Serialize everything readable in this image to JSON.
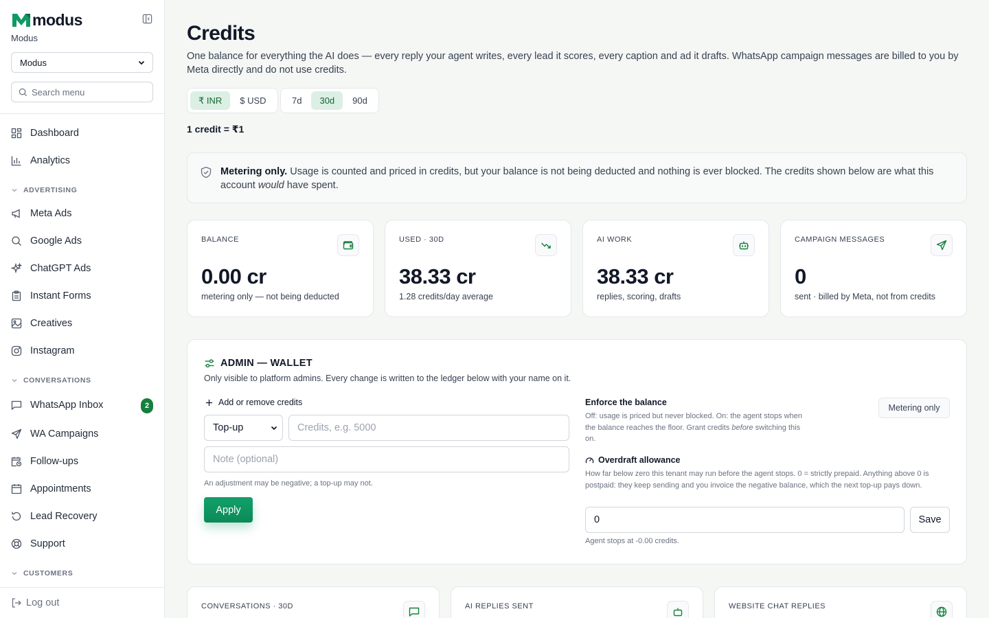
{
  "sidebar": {
    "brand_name": "modus",
    "org_label": "Modus",
    "org_select_value": "Modus",
    "search_placeholder": "Search menu",
    "nav": {
      "dashboard": "Dashboard",
      "analytics": "Analytics",
      "section_advertising": "ADVERTISING",
      "meta_ads": "Meta Ads",
      "google_ads": "Google Ads",
      "chatgpt_ads": "ChatGPT Ads",
      "instant_forms": "Instant Forms",
      "creatives": "Creatives",
      "instagram": "Instagram",
      "section_conversations": "CONVERSATIONS",
      "whatsapp_inbox": "WhatsApp Inbox",
      "whatsapp_inbox_badge": "2",
      "wa_campaigns": "WA Campaigns",
      "follow_ups": "Follow-ups",
      "appointments": "Appointments",
      "lead_recovery": "Lead Recovery",
      "support": "Support",
      "section_customers": "CUSTOMERS"
    },
    "logout": "Log out"
  },
  "header": {
    "title": "Credits",
    "description": "One balance for everything the AI does — every reply your agent writes, every lead it scores, every caption and ad it drafts. WhatsApp campaign messages are billed to you by Meta directly and do not use credits."
  },
  "currency_toggle": {
    "inr": "₹ INR",
    "usd": "$ USD",
    "active": "inr"
  },
  "range_toggle": {
    "d7": "7d",
    "d30": "30d",
    "d90": "90d",
    "active": "30d"
  },
  "rate": "1 credit = ₹1",
  "notice": {
    "bold": "Metering only.",
    "text1": " Usage is counted and priced in credits, but your balance is not being deducted and nothing is ever blocked. The credits shown below are what this account ",
    "italic": "would",
    "text2": " have spent."
  },
  "stats": {
    "balance": {
      "label": "BALANCE",
      "value": "0.00 cr",
      "sub": "metering only — not being deducted"
    },
    "used": {
      "label": "USED · 30D",
      "value": "38.33 cr",
      "sub": "1.28 credits/day average"
    },
    "ai_work": {
      "label": "AI WORK",
      "value": "38.33 cr",
      "sub": "replies, scoring, drafts"
    },
    "campaign": {
      "label": "CAMPAIGN MESSAGES",
      "value": "0",
      "sub": "sent · billed by Meta, not from credits"
    }
  },
  "wallet": {
    "title": "ADMIN — WALLET",
    "description": "Only visible to platform admins. Every change is written to the ledger below with your name on it.",
    "add_remove_title": "Add or remove credits",
    "type_value": "Top-up",
    "credits_placeholder": "Credits, e.g. 5000",
    "note_placeholder": "Note (optional)",
    "adjust_hint": "An adjustment may be negative; a top-up may not.",
    "apply_label": "Apply",
    "enforce_title": "Enforce the balance",
    "enforce_desc1": "Off: usage is priced but never blocked. On: the agent stops when the balance reaches the floor. Grant credits ",
    "enforce_desc_italic": "before",
    "enforce_desc2": " switching this on.",
    "metering_button": "Metering only",
    "overdraft_title": "Overdraft allowance",
    "overdraft_desc": "How far below zero this tenant may run before the agent stops. 0 = strictly prepaid. Anything above 0 is postpaid: they keep sending and you invoice the negative balance, which the next top-up pays down.",
    "overdraft_value": "0",
    "save_label": "Save",
    "stops_hint": "Agent stops at -0.00 credits."
  },
  "bottom_stats": {
    "conversations": "CONVERSATIONS · 30D",
    "ai_replies": "AI REPLIES SENT",
    "website_chat": "WEBSITE CHAT REPLIES"
  },
  "colors": {
    "accent": "#15803d",
    "apply": "#0f9a63",
    "bg": "#f5f7f5"
  }
}
